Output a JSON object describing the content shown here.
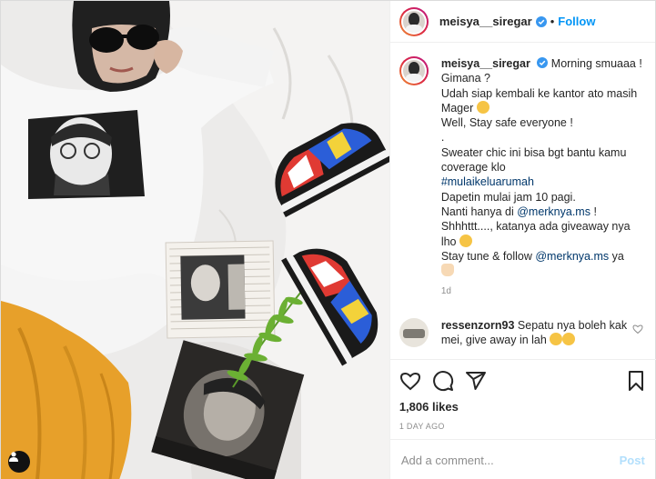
{
  "post": {
    "username": "meisya__siregar",
    "follow_label": "Follow",
    "separator": "•"
  },
  "caption": {
    "username": "meisya__siregar",
    "lines": [
      "Morning smuaaa ! Gimana ?",
      "Udah siap kembali ke kantor ato masih Mager",
      "Well, Stay safe everyone !",
      ".",
      "Sweater chic ini bisa bgt bantu kamu coverage klo",
      "#mulaikeluarumah",
      "Dapetin mulai jam 10 pagi.",
      "Nanti hanya di",
      "@merknya.ms",
      "!",
      "Shhhttt...., katanya ada giveaway nya lho",
      "Stay tune & follow",
      "@merknya.ms",
      "ya"
    ],
    "time": "1d"
  },
  "comment": {
    "username": "ressenzorn93",
    "text": "Sepatu nya boleh kak mei, give away in lah"
  },
  "actions": {
    "likes": "1,806 likes",
    "date": "1 day ago"
  },
  "add_comment": {
    "placeholder": "Add a comment...",
    "post_label": "Post"
  },
  "colors": {
    "accent": "#0095f6",
    "post_disabled": "#b2dffc",
    "link": "#00376b",
    "muted": "#8e8e8e",
    "sweater": "#f7f7f7",
    "skirt": "#e7a02a"
  },
  "icons": [
    "tag-user-icon",
    "verified-badge-icon",
    "heart-icon",
    "comment-icon",
    "share-icon",
    "save-icon",
    "comment-like-icon",
    "smile-emoji-icon",
    "heart-eyes-emoji-icon",
    "pray-emoji-icon"
  ]
}
